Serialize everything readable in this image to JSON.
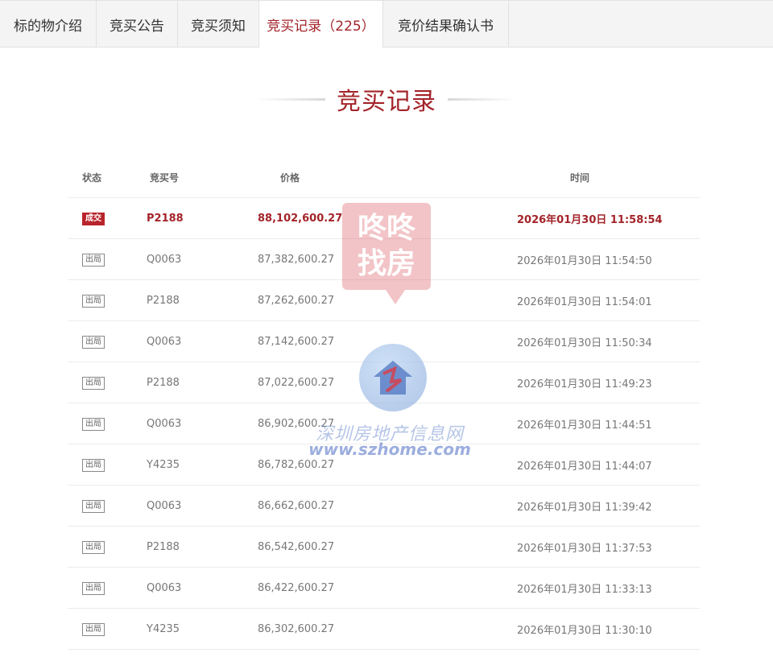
{
  "tabs": [
    {
      "label": "标的物介绍"
    },
    {
      "label": "竞买公告"
    },
    {
      "label": "竞买须知"
    },
    {
      "label": "竞买记录（225）"
    },
    {
      "label": "竞价结果确认书"
    }
  ],
  "section_title": "竞买记录",
  "table": {
    "headers": {
      "status": "状态",
      "bid_no": "竞买号",
      "price": "价格",
      "time": "时间"
    },
    "rows": [
      {
        "status": "成交",
        "bid_no": "P2188",
        "price": "88,102,600.27",
        "time": "2026年01月30日 11:58:54"
      },
      {
        "status": "出局",
        "bid_no": "Q0063",
        "price": "87,382,600.27",
        "time": "2026年01月30日 11:54:50"
      },
      {
        "status": "出局",
        "bid_no": "P2188",
        "price": "87,262,600.27",
        "time": "2026年01月30日 11:54:01"
      },
      {
        "status": "出局",
        "bid_no": "Q0063",
        "price": "87,142,600.27",
        "time": "2026年01月30日 11:50:34"
      },
      {
        "status": "出局",
        "bid_no": "P2188",
        "price": "87,022,600.27",
        "time": "2026年01月30日 11:49:23"
      },
      {
        "status": "出局",
        "bid_no": "Q0063",
        "price": "86,902,600.27",
        "time": "2026年01月30日 11:44:51"
      },
      {
        "status": "出局",
        "bid_no": "Y4235",
        "price": "86,782,600.27",
        "time": "2026年01月30日 11:44:07"
      },
      {
        "status": "出局",
        "bid_no": "Q0063",
        "price": "86,662,600.27",
        "time": "2026年01月30日 11:39:42"
      },
      {
        "status": "出局",
        "bid_no": "P2188",
        "price": "86,542,600.27",
        "time": "2026年01月30日 11:37:53"
      },
      {
        "status": "出局",
        "bid_no": "Q0063",
        "price": "86,422,600.27",
        "time": "2026年01月30日 11:33:13"
      },
      {
        "status": "出局",
        "bid_no": "Y4235",
        "price": "86,302,600.27",
        "time": "2026年01月30日 11:30:10"
      }
    ]
  },
  "watermarks": {
    "logo1_line1": "咚咚",
    "logo1_line2": "找房",
    "site_name": "深圳房地产信息网",
    "site_url": "www.szhome.com"
  },
  "colors": {
    "accent": "#a3242a",
    "deal_badge": "#b8242b"
  }
}
